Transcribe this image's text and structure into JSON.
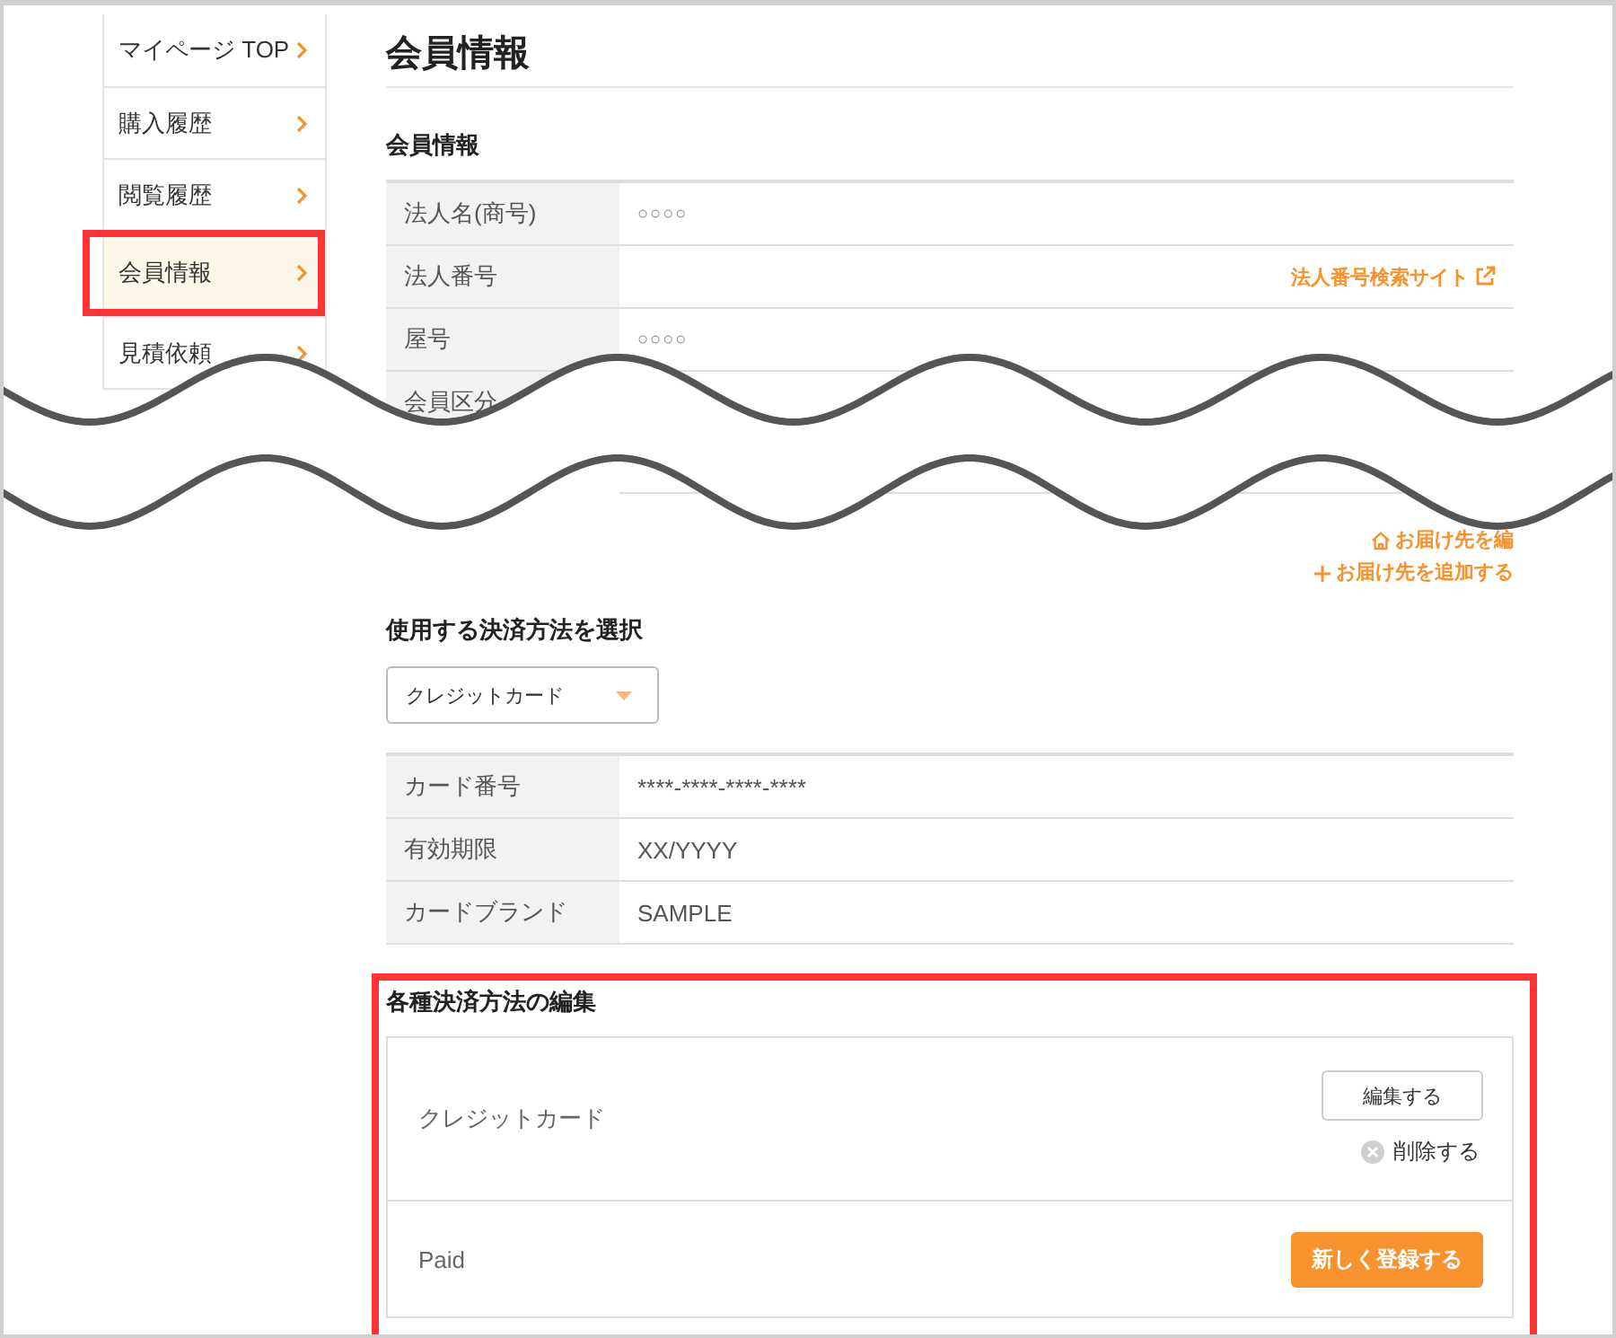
{
  "sidebar": {
    "items": [
      {
        "label": "マイページ TOP",
        "selected": false,
        "highlighted": false
      },
      {
        "label": "購入履歴",
        "selected": false,
        "highlighted": false
      },
      {
        "label": "閲覧履歴",
        "selected": false,
        "highlighted": false
      },
      {
        "label": "会員情報",
        "selected": true,
        "highlighted": true
      },
      {
        "label": "見積依頼",
        "selected": false,
        "highlighted": false
      }
    ]
  },
  "page_title": "会員情報",
  "member_info": {
    "heading": "会員情報",
    "rows": [
      {
        "label": "法人名(商号)",
        "value": "○○○○"
      },
      {
        "label": "法人番号",
        "link": "法人番号検索サイト"
      },
      {
        "label": "屋号",
        "value": "○○○○"
      },
      {
        "label": "会員区分"
      }
    ]
  },
  "address_links": [
    {
      "kind": "edit",
      "label": "お届け先を編"
    },
    {
      "kind": "add",
      "label": "お届け先を追加する"
    }
  ],
  "payment_select": {
    "heading": "使用する決済方法を選択",
    "value": "クレジットカード"
  },
  "card_info": {
    "rows": [
      {
        "label": "カード番号",
        "value": "****-****-****-****"
      },
      {
        "label": "有効期限",
        "value": "XX/YYYY"
      },
      {
        "label": "カードブランド",
        "value": "SAMPLE"
      }
    ]
  },
  "payment_edit": {
    "highlighted": true,
    "heading": "各種決済方法の編集",
    "methods": [
      {
        "kind": "registered",
        "name": "クレジットカード",
        "edit_label": "編集する",
        "delete_label": "削除する"
      },
      {
        "kind": "unregistered",
        "name": "Paid",
        "register_label": "新しく登録する"
      }
    ]
  },
  "break_lines": [
    {
      "kind": "wave"
    },
    {
      "kind": "wave"
    }
  ]
}
